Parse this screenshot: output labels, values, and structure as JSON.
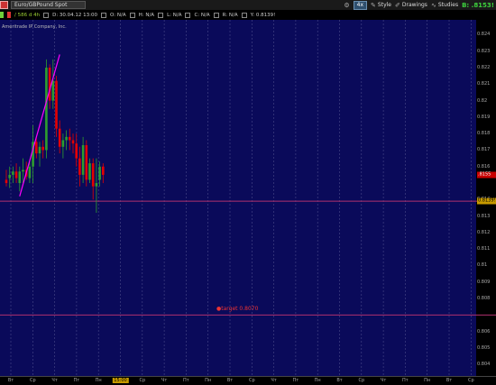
{
  "toolbar": {
    "symbol": "Euro/GBPound Spot",
    "timeframe": "4x",
    "buttons": {
      "style": "Style",
      "drawings": "Drawings",
      "studies": "Studies"
    },
    "bid_prefix": "B:",
    "bid_value": ".8153!"
  },
  "info_bar": {
    "symbol": "/ 586 d 4h",
    "date": "D: 30.04.12 13:00",
    "open": "O: N/A",
    "high": "H: N/A",
    "low": "L: N/A",
    "close": "C: N/A",
    "range": "R: N/A",
    "y": "Y: 0.8139!"
  },
  "chart": {
    "watermark": "Ameritrade IP Company, Inc.",
    "target_label": "target 0.8070",
    "price_labels": [
      ".8155",
      "0.8139!"
    ],
    "y_ticks": [
      {
        "v": 0.824,
        "t": "0.824"
      },
      {
        "v": 0.823,
        "t": "0.823"
      },
      {
        "v": 0.822,
        "t": "0.822"
      },
      {
        "v": 0.821,
        "t": "0.821"
      },
      {
        "v": 0.82,
        "t": "0.82"
      },
      {
        "v": 0.819,
        "t": "0.819"
      },
      {
        "v": 0.818,
        "t": "0.818"
      },
      {
        "v": 0.817,
        "t": "0.817"
      },
      {
        "v": 0.816,
        "t": "0.816"
      },
      {
        "v": 0.814,
        "t": "0.814"
      },
      {
        "v": 0.813,
        "t": "0.813"
      },
      {
        "v": 0.812,
        "t": "0.812"
      },
      {
        "v": 0.811,
        "t": "0.811"
      },
      {
        "v": 0.81,
        "t": "0.81"
      },
      {
        "v": 0.809,
        "t": "0.809"
      },
      {
        "v": 0.808,
        "t": "0.808"
      },
      {
        "v": 0.806,
        "t": "0.806"
      },
      {
        "v": 0.805,
        "t": "0.805"
      },
      {
        "v": 0.804,
        "t": "0.804"
      }
    ],
    "x_labels": [
      "Вт",
      "Ср",
      "Чт",
      "Пт",
      "Пн",
      "15:00",
      "Ср",
      "Чт",
      "Пт",
      "Пн",
      "Вт",
      "Ср",
      "Чт",
      "Пт",
      "Пн",
      "Вт",
      "Ср",
      "Чт",
      "Пт",
      "Пн",
      "Вт",
      "Ср"
    ],
    "active_x_index": 5
  },
  "chart_data": {
    "type": "candlestick",
    "title": "Euro/GBPound Spot",
    "ylim": [
      0.8033,
      0.8249
    ],
    "horizontal_lines": [
      0.8139,
      0.807
    ],
    "last_price": 0.8155,
    "candles": [
      {
        "o": 0.8152,
        "h": 0.8158,
        "l": 0.8148,
        "c": 0.815
      },
      {
        "o": 0.8153,
        "h": 0.816,
        "l": 0.8147,
        "c": 0.8155
      },
      {
        "o": 0.8155,
        "h": 0.816,
        "l": 0.815,
        "c": 0.8157
      },
      {
        "o": 0.8157,
        "h": 0.8162,
        "l": 0.815,
        "c": 0.8153
      },
      {
        "o": 0.815,
        "h": 0.816,
        "l": 0.8145,
        "c": 0.8157
      },
      {
        "o": 0.8157,
        "h": 0.8165,
        "l": 0.815,
        "c": 0.8158
      },
      {
        "o": 0.8158,
        "h": 0.8163,
        "l": 0.8152,
        "c": 0.8154
      },
      {
        "o": 0.8153,
        "h": 0.8164,
        "l": 0.815,
        "c": 0.816
      },
      {
        "o": 0.816,
        "h": 0.8185,
        "l": 0.815,
        "c": 0.8175
      },
      {
        "o": 0.8175,
        "h": 0.8178,
        "l": 0.8165,
        "c": 0.8168
      },
      {
        "o": 0.8168,
        "h": 0.8175,
        "l": 0.816,
        "c": 0.8172
      },
      {
        "o": 0.8172,
        "h": 0.8176,
        "l": 0.8165,
        "c": 0.817
      },
      {
        "o": 0.817,
        "h": 0.8225,
        "l": 0.8165,
        "c": 0.822
      },
      {
        "o": 0.822,
        "h": 0.8222,
        "l": 0.8195,
        "c": 0.82
      },
      {
        "o": 0.82,
        "h": 0.8225,
        "l": 0.8195,
        "c": 0.8212
      },
      {
        "o": 0.8212,
        "h": 0.8215,
        "l": 0.8178,
        "c": 0.8183
      },
      {
        "o": 0.8183,
        "h": 0.8188,
        "l": 0.8168,
        "c": 0.8172
      },
      {
        "o": 0.8172,
        "h": 0.818,
        "l": 0.8165,
        "c": 0.8176
      },
      {
        "o": 0.8176,
        "h": 0.8182,
        "l": 0.817,
        "c": 0.8178
      },
      {
        "o": 0.8178,
        "h": 0.8183,
        "l": 0.817,
        "c": 0.8176
      },
      {
        "o": 0.8176,
        "h": 0.818,
        "l": 0.8168,
        "c": 0.8174
      },
      {
        "o": 0.8174,
        "h": 0.818,
        "l": 0.816,
        "c": 0.8165
      },
      {
        "o": 0.8165,
        "h": 0.8172,
        "l": 0.8148,
        "c": 0.8155
      },
      {
        "o": 0.8155,
        "h": 0.8178,
        "l": 0.815,
        "c": 0.8173
      },
      {
        "o": 0.8173,
        "h": 0.8176,
        "l": 0.8148,
        "c": 0.8152
      },
      {
        "o": 0.8152,
        "h": 0.8165,
        "l": 0.815,
        "c": 0.8162
      },
      {
        "o": 0.8162,
        "h": 0.8165,
        "l": 0.814,
        "c": 0.8148
      },
      {
        "o": 0.8148,
        "h": 0.8165,
        "l": 0.8132,
        "c": 0.815
      },
      {
        "o": 0.8152,
        "h": 0.8163,
        "l": 0.8148,
        "c": 0.816
      },
      {
        "o": 0.816,
        "h": 0.8162,
        "l": 0.815,
        "c": 0.8155
      }
    ],
    "trend_line": {
      "from": {
        "candle": 4,
        "price": 0.8142
      },
      "to": {
        "candle": 16,
        "price": 0.8228
      }
    },
    "colors": {
      "up": "#2e9e2e",
      "down": "#e60000",
      "background": "#0a0a5a",
      "grid": "#4a4a8a",
      "trend": "#ff00ff",
      "level": "#b0306e",
      "target": "#e33333"
    }
  }
}
